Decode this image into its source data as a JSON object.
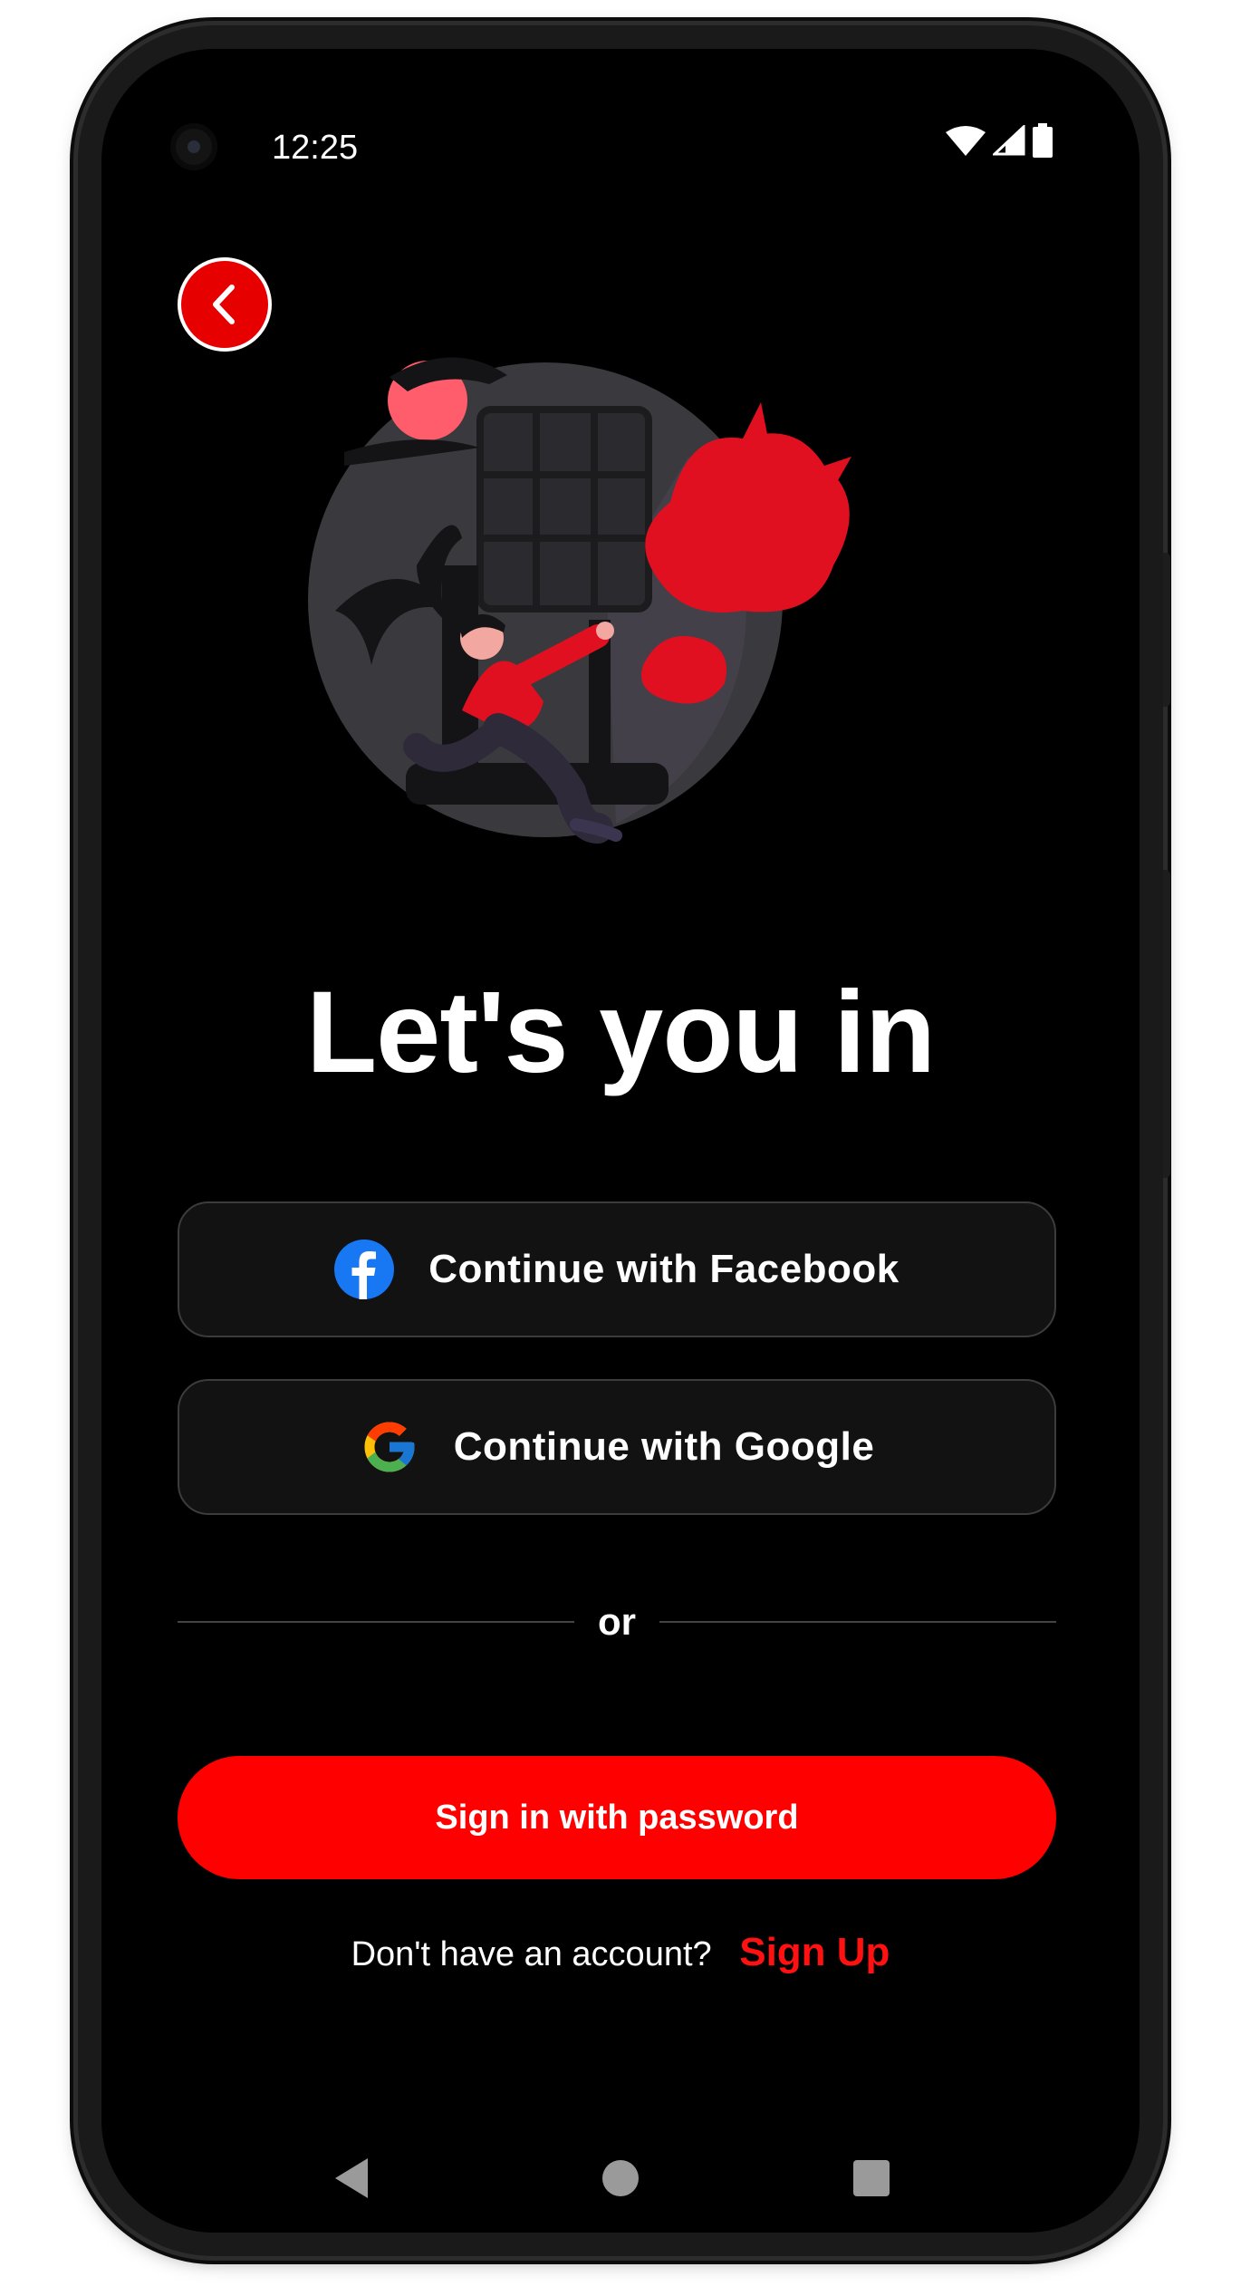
{
  "status_bar": {
    "time": "12:25",
    "icons": [
      "wifi-icon",
      "cell-signal-icon",
      "battery-icon"
    ]
  },
  "back_button": {
    "icon": "chevron-left-icon"
  },
  "title": "Let's you in",
  "social_buttons": [
    {
      "label": "Continue with Facebook",
      "icon": "facebook-icon"
    },
    {
      "label": "Continue with Google",
      "icon": "google-icon"
    }
  ],
  "divider_label": "or",
  "primary_button": {
    "label": "Sign in with password"
  },
  "signup_prompt": {
    "text": "Don't have an account?",
    "link": "Sign Up"
  },
  "nav_bar": [
    "back-triangle-icon",
    "home-circle-icon",
    "recents-square-icon"
  ],
  "colors": {
    "accent": "#ff0000",
    "background": "#000000",
    "button_surface": "#121212",
    "link": "#ff1111"
  }
}
